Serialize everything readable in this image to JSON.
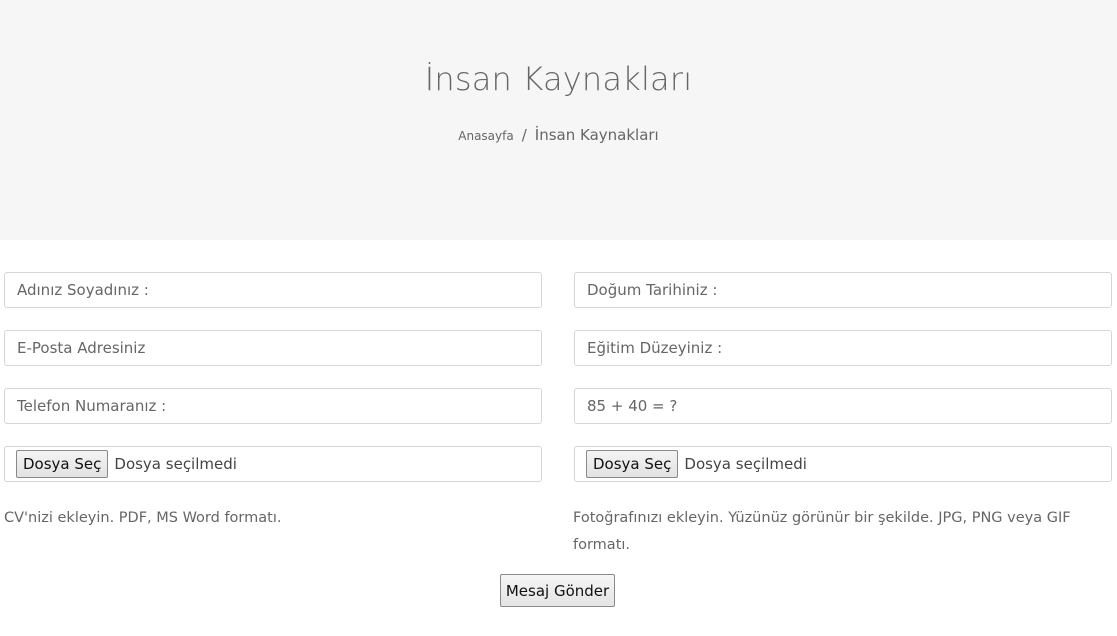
{
  "header": {
    "title": "İnsan Kaynakları",
    "breadcrumb": {
      "home_label": "Anasayfa",
      "separator": "/",
      "current_label": "İnsan Kaynakları"
    }
  },
  "form": {
    "name_placeholder": "Adınız Soyadınız :",
    "birthdate_placeholder": "Doğum Tarihiniz :",
    "email_placeholder": "E-Posta Adresiniz",
    "education_placeholder": "Eğitim Düzeyiniz :",
    "phone_placeholder": "Telefon Numaranız :",
    "captcha_placeholder": "85 + 40 = ?",
    "cv_upload": {
      "button_label": "Dosya Seç",
      "status": "Dosya seçilmedi",
      "help": "CV'nizi ekleyin. PDF, MS Word formatı."
    },
    "photo_upload": {
      "button_label": "Dosya Seç",
      "status": "Dosya seçilmedi",
      "help": "Fotoğrafınızı ekleyin. Yüzünüz görünür bir şekilde. JPG, PNG veya GIF formatı."
    },
    "submit_label": "Mesaj Gönder"
  },
  "colors": {
    "hero_background": "#f6f6f6",
    "text": "#666666",
    "border": "#d6d6d6"
  }
}
